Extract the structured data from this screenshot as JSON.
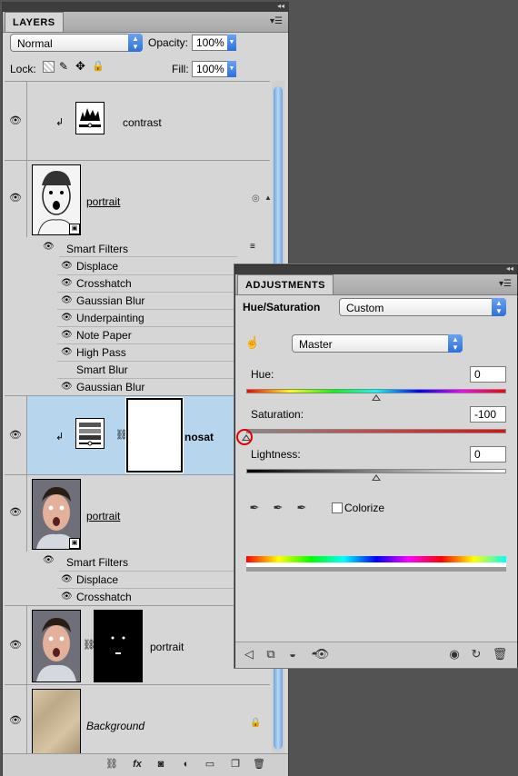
{
  "layers_panel": {
    "tab_label": "LAYERS",
    "blend_mode": "Normal",
    "opacity_label": "Opacity:",
    "opacity_value": "100%",
    "lock_label": "Lock:",
    "fill_label": "Fill:",
    "fill_value": "100%",
    "layers": [
      {
        "name": "contrast",
        "type": "adjustment"
      },
      {
        "name": "portrait",
        "type": "smart-object-sketch"
      },
      {
        "name": "nosat",
        "type": "adjustment-with-mask",
        "selected": true
      },
      {
        "name": "portrait",
        "type": "smart-object-photo"
      },
      {
        "name": "portrait",
        "type": "photo-with-mask"
      },
      {
        "name": "Background",
        "type": "background"
      }
    ],
    "smart_filters_group_1": {
      "label": "Smart Filters",
      "filters": [
        {
          "name": "Displace",
          "visible": true
        },
        {
          "name": "Crosshatch",
          "visible": true
        },
        {
          "name": "Gaussian Blur",
          "visible": true
        },
        {
          "name": "Underpainting",
          "visible": true
        },
        {
          "name": "Note Paper",
          "visible": true
        },
        {
          "name": "High Pass",
          "visible": true
        },
        {
          "name": "Smart Blur",
          "visible": false
        },
        {
          "name": "Gaussian Blur",
          "visible": true
        }
      ]
    },
    "smart_filters_group_2": {
      "label": "Smart Filters",
      "filters": [
        {
          "name": "Displace",
          "visible": true
        },
        {
          "name": "Crosshatch",
          "visible": true
        }
      ]
    },
    "bottom_icons": [
      "link-icon",
      "fx-icon",
      "mask-icon",
      "adjustment-icon",
      "folder-icon",
      "new-layer-icon",
      "trash-icon"
    ]
  },
  "adjustments_panel": {
    "tab_label": "ADJUSTMENTS",
    "adjustment_type": "Hue/Saturation",
    "preset": "Custom",
    "channel": "Master",
    "hue_label": "Hue:",
    "hue_value": "0",
    "saturation_label": "Saturation:",
    "saturation_value": "-100",
    "lightness_label": "Lightness:",
    "lightness_value": "0",
    "colorize_label": "Colorize",
    "colorize_checked": false,
    "slider_levels": {
      "hue": 0.5,
      "saturation": 0.0,
      "lightness": 0.5
    }
  },
  "colors": {
    "panel_bg": "#d6d6d6",
    "selection": "#b7d6ee",
    "accent": "#2d6fd8",
    "highlight_circle": "#e00000"
  }
}
